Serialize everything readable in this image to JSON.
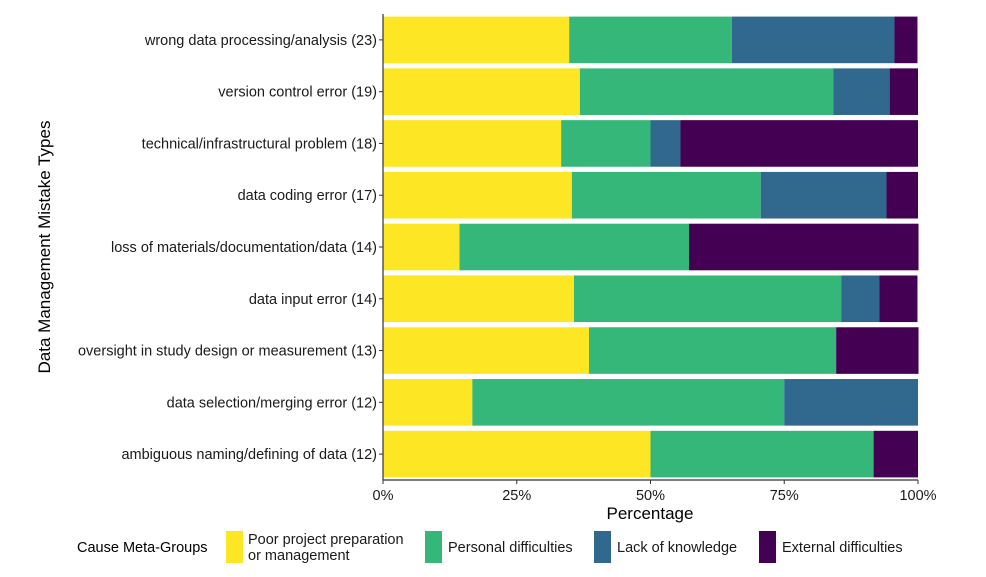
{
  "chart_data": {
    "type": "bar",
    "orientation": "horizontal",
    "stacked": true,
    "normalized": true,
    "title": "",
    "xlabel": "Percentage",
    "ylabel": "Data Management Mistake Types",
    "xlim": [
      0,
      100
    ],
    "x_ticks": [
      "0%",
      "25%",
      "50%",
      "75%",
      "100%"
    ],
    "x_tick_values": [
      0,
      25,
      50,
      75,
      100
    ],
    "grid": false,
    "categories": [
      "wrong data processing/analysis (23)",
      "version control error (19)",
      "technical/infrastructural problem (18)",
      "data coding error (17)",
      "loss of materials/documentation/data (14)",
      "data input error (14)",
      "oversight in study design or measurement (13)",
      "data selection/merging error (12)",
      "ambiguous naming/defining of data (12)"
    ],
    "series": [
      {
        "name": "Poor project preparation or management",
        "color": "#fde725",
        "values": [
          34.8,
          36.8,
          33.3,
          35.3,
          14.3,
          35.7,
          38.5,
          16.7,
          50.0
        ]
      },
      {
        "name": "Personal difficulties",
        "color": "#35b779",
        "values": [
          30.4,
          47.4,
          16.7,
          35.3,
          42.9,
          50.0,
          46.2,
          58.3,
          41.7
        ]
      },
      {
        "name": "Lack of knowledge",
        "color": "#31688e",
        "values": [
          30.4,
          10.5,
          5.6,
          23.5,
          0,
          7.1,
          0,
          25.0,
          0
        ]
      },
      {
        "name": "External difficulties",
        "color": "#440154",
        "values": [
          4.3,
          5.3,
          44.4,
          5.9,
          42.9,
          7.1,
          15.4,
          0,
          8.3
        ]
      }
    ],
    "legend": {
      "title": "Cause Meta-Groups",
      "placement": "bottom",
      "entries": [
        {
          "lines": [
            "Poor project preparation",
            "or management"
          ],
          "color": "#fde725"
        },
        {
          "lines": [
            "Personal difficulties"
          ],
          "color": "#35b779"
        },
        {
          "lines": [
            "Lack of knowledge"
          ],
          "color": "#31688e"
        },
        {
          "lines": [
            "External difficulties"
          ],
          "color": "#440154"
        }
      ]
    }
  }
}
